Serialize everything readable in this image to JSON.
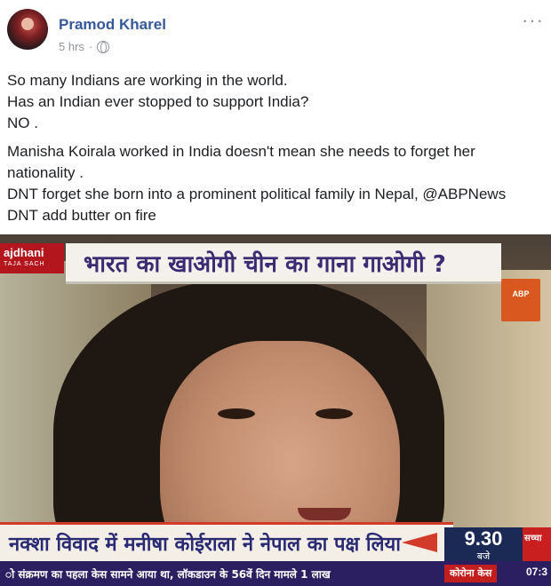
{
  "post": {
    "author": "Pramod Kharel",
    "time": "5 hrs",
    "separator": "·",
    "privacy_icon": "globe-icon",
    "more_label": "···"
  },
  "body": {
    "paragraphs": [
      [
        "So many Indians are working in the world.",
        "Has an Indian ever stopped to support India?",
        "NO ."
      ],
      [
        "Manisha Koirala worked in India doesn't mean she needs to forget her",
        "nationality .",
        "DNT forget she born into a prominent political family in Nepal, @ABPNews",
        "DNT add butter on fire"
      ]
    ]
  },
  "photo": {
    "channel_logo": "ajdhani",
    "channel_sub": "TAJA SACH",
    "headline": "भारत का खाओगी चीन का गाना गाओगी ?",
    "abp_logo": "ABP",
    "ticker": "नक्शा विवाद में मनीषा कोईराला ने नेपाल का पक्ष लिया",
    "time": "9.30",
    "time_sub": "बजे",
    "side_label": "सच्चा",
    "crawl": "ो संक्रमण का पहला केस सामने आया था, लॉकडाउन के 56वें दिन मामले 1 लाख",
    "crawl_tag": "कोरोना केस",
    "crawl_time": "07:3"
  }
}
